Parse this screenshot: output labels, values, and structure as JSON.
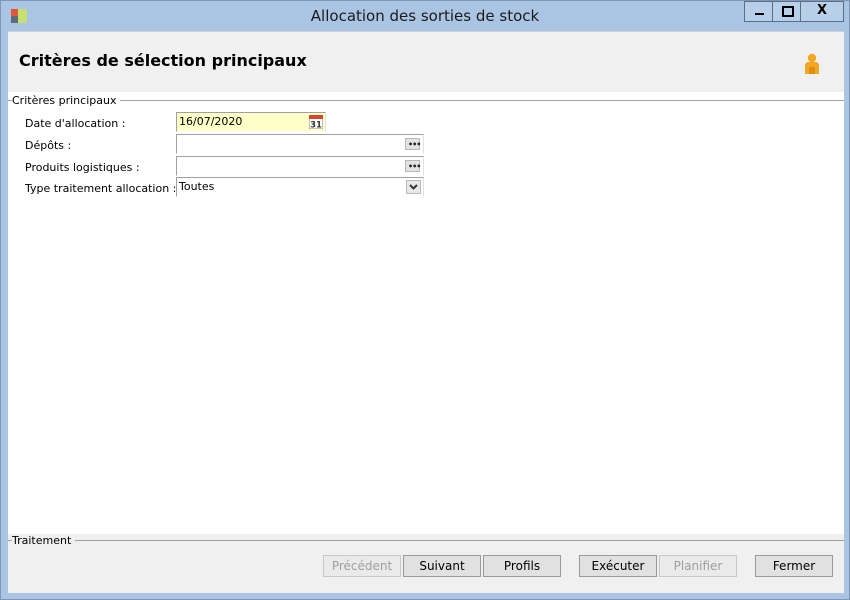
{
  "window": {
    "title": "Allocation des sorties de stock",
    "controls": {
      "minimize": "minimize-icon",
      "maximize": "maximize-icon",
      "close": "X"
    }
  },
  "header": {
    "title": "Critères de sélection principaux",
    "icon": "user-icon"
  },
  "criteria": {
    "group_label": "Critères principaux",
    "fields": {
      "date": {
        "label": "Date d'allocation :",
        "value": "16/07/2020",
        "icon": "calendar-icon",
        "icon_text": "31"
      },
      "depots": {
        "label": "Dépôts :",
        "value": "",
        "icon": "ellipsis-icon"
      },
      "products": {
        "label": "Produits logistiques :",
        "value": "",
        "icon": "ellipsis-icon"
      },
      "type": {
        "label": "Type traitement allocation :",
        "value": "Toutes",
        "icon": "chevron-down-icon"
      }
    }
  },
  "footer": {
    "group_label": "Traitement",
    "buttons": {
      "previous": {
        "label": "Précédent",
        "enabled": false
      },
      "next": {
        "label": "Suivant",
        "enabled": true
      },
      "profiles": {
        "label": "Profils",
        "enabled": true
      },
      "execute": {
        "label": "Exécuter",
        "enabled": true
      },
      "schedule": {
        "label": "Planifier",
        "enabled": false
      },
      "close": {
        "label": "Fermer",
        "enabled": true
      }
    }
  },
  "colors": {
    "titlebar": "#aac4e3",
    "date_field_bg": "#ffffc8",
    "user_icon": "#f5a623"
  }
}
